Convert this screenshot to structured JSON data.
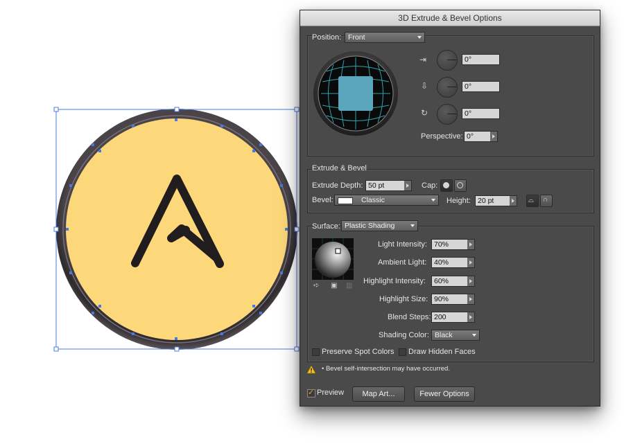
{
  "canvas": {
    "letter": "A",
    "fill_color": "#FDD87A",
    "rim_color": "#3A3539",
    "selection_color": "#4A78E0"
  },
  "dialog": {
    "title": "3D Extrude & Bevel Options",
    "position": {
      "label": "Position:",
      "value": "Front",
      "rotations": [
        {
          "icon": "x-axis-rotate-icon",
          "value": "0°"
        },
        {
          "icon": "y-axis-rotate-icon",
          "value": "0°"
        },
        {
          "icon": "z-axis-rotate-icon",
          "value": "0°"
        }
      ],
      "perspective_label": "Perspective:",
      "perspective_value": "0°"
    },
    "extrude": {
      "section_title": "Extrude & Bevel",
      "depth_label": "Extrude Depth:",
      "depth_value": "50 pt",
      "cap_label": "Cap:",
      "bevel_label": "Bevel:",
      "bevel_value": "Classic",
      "height_label": "Height:",
      "height_value": "20 pt"
    },
    "surface": {
      "label": "Surface:",
      "value": "Plastic Shading",
      "light_intensity_label": "Light Intensity:",
      "light_intensity_value": "70%",
      "ambient_light_label": "Ambient Light:",
      "ambient_light_value": "40%",
      "highlight_intensity_label": "Highlight Intensity:",
      "highlight_intensity_value": "60%",
      "highlight_size_label": "Highlight Size:",
      "highlight_size_value": "90%",
      "blend_steps_label": "Blend Steps:",
      "blend_steps_value": "200",
      "shading_color_label": "Shading Color:",
      "shading_color_value": "Black",
      "preserve_spot_label": "Preserve Spot Colors",
      "draw_hidden_label": "Draw Hidden Faces"
    },
    "warning": "• Bevel self-intersection may have occurred.",
    "preview_label": "Preview",
    "map_art_label": "Map Art...",
    "fewer_options_label": "Fewer Options"
  }
}
